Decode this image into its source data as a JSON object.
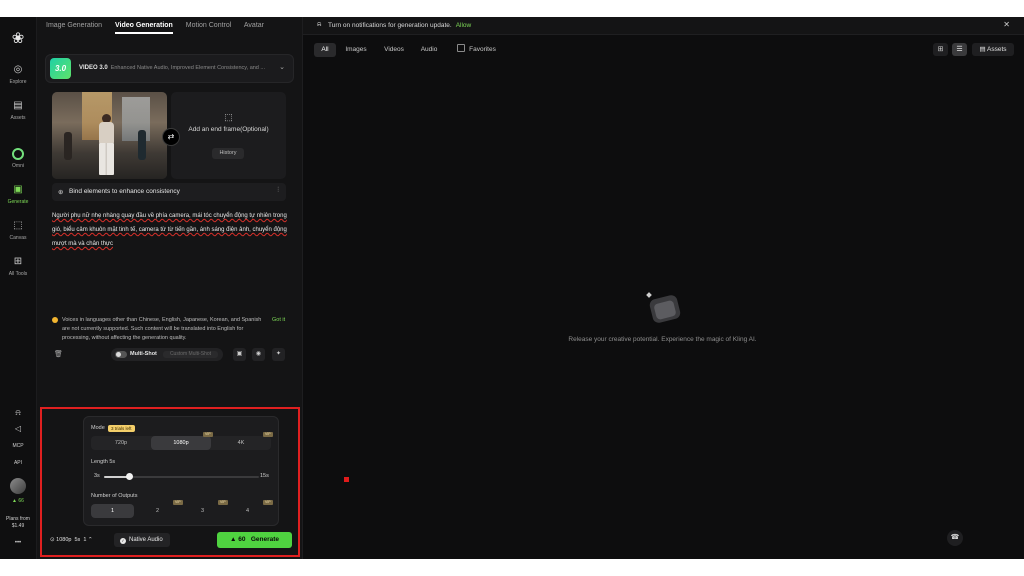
{
  "app": {
    "logo": "kling-logo-icon"
  },
  "rail": {
    "items": [
      {
        "label": "Explore",
        "icon": "explore-icon"
      },
      {
        "label": "Assets",
        "icon": "folder-icon"
      },
      {
        "label": "Omni",
        "icon": "omni-icon"
      },
      {
        "label": "Generate",
        "icon": "generate-icon"
      },
      {
        "label": "Canvas",
        "icon": "canvas-icon"
      },
      {
        "label": "All Tools",
        "icon": "grid-icon"
      }
    ],
    "mcp": "MCP",
    "api": "API",
    "credits": "66",
    "plans_line1": "Plans from",
    "plans_line2": "$1.49",
    "more": "•••"
  },
  "panel": {
    "tabs": [
      "Image Generation",
      "Video Generation",
      "Motion Control",
      "Avatar"
    ],
    "model": {
      "badge": "3.0",
      "name": "VIDEO 3.0",
      "desc": "Enhanced Native Audio, Improved Element Consistency, and ..."
    },
    "end_frame_label": "Add an end frame(Optional)",
    "history_label": "History",
    "bind_label": "Bind elements to enhance consistency",
    "prompt": "Người phụ nữ nhẹ nhàng quay đầu về phía camera, mái tóc chuyển động tự nhiên trong gió, biểu cảm khuôn mặt tinh tế, camera từ từ tiến gần, ánh sáng điện ảnh, chuyển động mượt mà và chân thực",
    "warning": "Voices in languages other than Chinese, English, Japanese, Korean, and Spanish are not currently supported. Such content will be translated into English for processing, without affecting the generation quality.",
    "got_it": "Got it",
    "multishot_label": "Multi-Shot",
    "multishot_custom": "Custom Multi-Shot"
  },
  "settings": {
    "mode_label": "Mode",
    "trial_badge": "3 trials left",
    "resolutions": [
      "720p",
      "1080p",
      "4K"
    ],
    "resolution_selected": "1080p",
    "vip_tag": "VIP",
    "length_label": "Length 5s",
    "length_min": "3s",
    "length_max": "15s",
    "length_value": 5,
    "length_range": [
      3,
      15
    ],
    "outputs_label": "Number of Outputs",
    "outputs": [
      "1",
      "2",
      "3",
      "4"
    ],
    "outputs_selected": "1"
  },
  "bottom": {
    "res": "1080p",
    "len": "5s",
    "count": "1",
    "native_audio": "Native Audio",
    "generate_cost": "60",
    "generate_label": "Generate"
  },
  "right": {
    "notice": "Turn on notifications for generation update.",
    "allow": "Allow",
    "filters": [
      "All",
      "Images",
      "Videos",
      "Audio"
    ],
    "favorites": "Favorites",
    "assets": "Assets",
    "empty_text": "Release your creative potential. Experience the magic of Kling AI."
  },
  "colors": {
    "accent": "#4fd340",
    "highlight": "#e02020",
    "trial": "#f4cf6a"
  }
}
